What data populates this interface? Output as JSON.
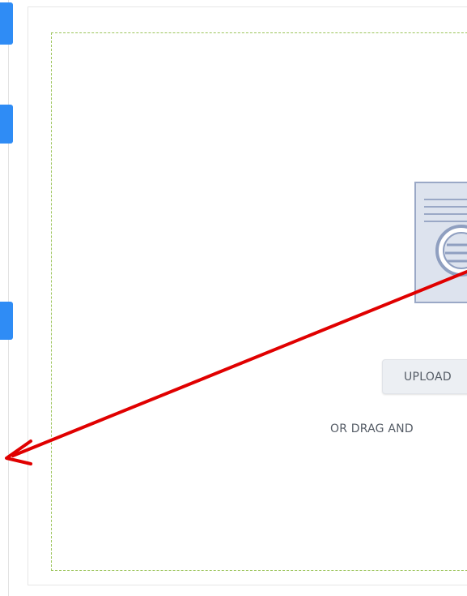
{
  "upload": {
    "button_label": "UPLOAD",
    "drag_text": "OR DRAG AND"
  },
  "icons": {
    "document": "document-icon",
    "arrow": "annotation-arrow-icon"
  },
  "colors": {
    "accent_blue": "#2f8cf5",
    "dropzone_border": "#9bc45a",
    "annotation_red": "#e00000",
    "doc_icon": "#8f9fc0"
  }
}
